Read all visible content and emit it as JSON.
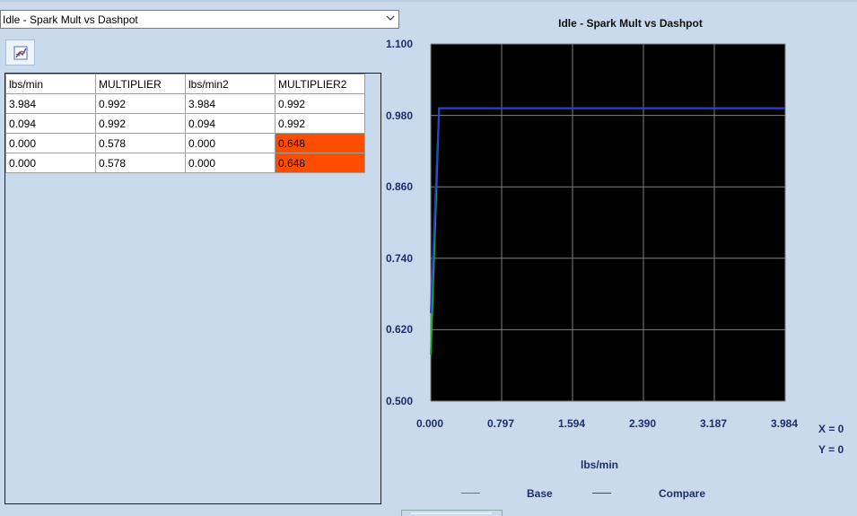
{
  "dropdown": {
    "selected": "Idle - Spark Mult vs Dashpot"
  },
  "toolbar": {
    "chart_button_icon": "chart-icon"
  },
  "table": {
    "columns": [
      "lbs/min",
      "MULTIPLIER",
      "lbs/min2",
      "MULTIPLIER2"
    ],
    "rows": [
      [
        "3.984",
        "0.992",
        "3.984",
        "0.992"
      ],
      [
        "0.094",
        "0.992",
        "0.094",
        "0.992"
      ],
      [
        "0.000",
        "0.578",
        "0.000",
        "0.648"
      ],
      [
        "0.000",
        "0.578",
        "0.000",
        "0.648"
      ]
    ],
    "highlight_color": "#ff4d00"
  },
  "readout": {
    "x": "X = 0",
    "y": "Y = 0"
  },
  "chart_data": {
    "type": "line",
    "title": "Idle - Spark Mult vs Dashpot",
    "xlabel": "lbs/min",
    "ylabel": "",
    "xlim": [
      0,
      3.984
    ],
    "ylim": [
      0.5,
      1.1
    ],
    "xticks": [
      "0.000",
      "0.797",
      "1.594",
      "2.390",
      "3.187",
      "3.984"
    ],
    "yticks": [
      "1.100",
      "0.980",
      "0.860",
      "0.740",
      "0.620",
      "0.500"
    ],
    "grid": true,
    "background": "#000000",
    "legend_position": "bottom",
    "series": [
      {
        "name": "Base",
        "color": "#22b022",
        "x": [
          0.0,
          0.0,
          0.094,
          3.984
        ],
        "y": [
          0.578,
          0.578,
          0.992,
          0.992
        ]
      },
      {
        "name": "Compare",
        "color": "#2a3fd6",
        "x": [
          0.0,
          0.0,
          0.094,
          3.984
        ],
        "y": [
          0.648,
          0.648,
          0.992,
          0.992
        ]
      }
    ]
  }
}
